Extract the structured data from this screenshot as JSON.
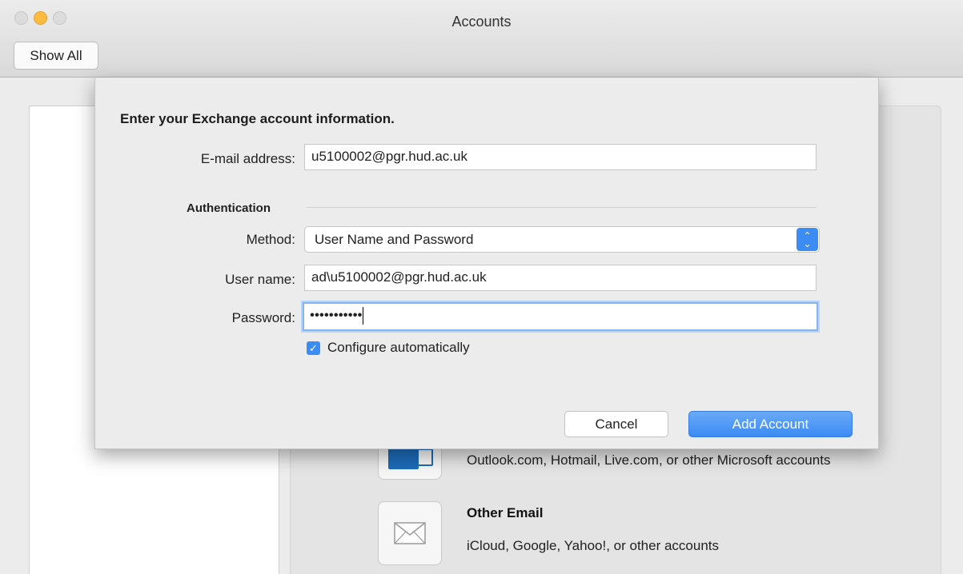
{
  "window": {
    "title": "Accounts",
    "toolbar": {
      "show_all_label": "Show All"
    }
  },
  "background": {
    "accounts": [
      {
        "name": "",
        "description": "Outlook.com, Hotmail, Live.com, or other Microsoft accounts",
        "icon": "outlook-icon"
      },
      {
        "name": "Other Email",
        "description": "iCloud, Google, Yahoo!, or other accounts",
        "icon": "envelope-icon"
      }
    ]
  },
  "sheet": {
    "heading": "Enter your Exchange account information.",
    "email": {
      "label": "E-mail address:",
      "value": "u5100002@pgr.hud.ac.uk"
    },
    "auth_section": "Authentication",
    "method": {
      "label": "Method:",
      "value": "User Name and Password"
    },
    "username": {
      "label": "User name:",
      "value": "ad\\u5100002@pgr.hud.ac.uk"
    },
    "password": {
      "label": "Password:",
      "value": "•••••••••••"
    },
    "configure": {
      "label": "Configure automatically",
      "checked": true
    },
    "cancel_label": "Cancel",
    "add_label": "Add Account"
  },
  "colors": {
    "accent": "#3b8af2",
    "minimize": "#fdbc40"
  }
}
